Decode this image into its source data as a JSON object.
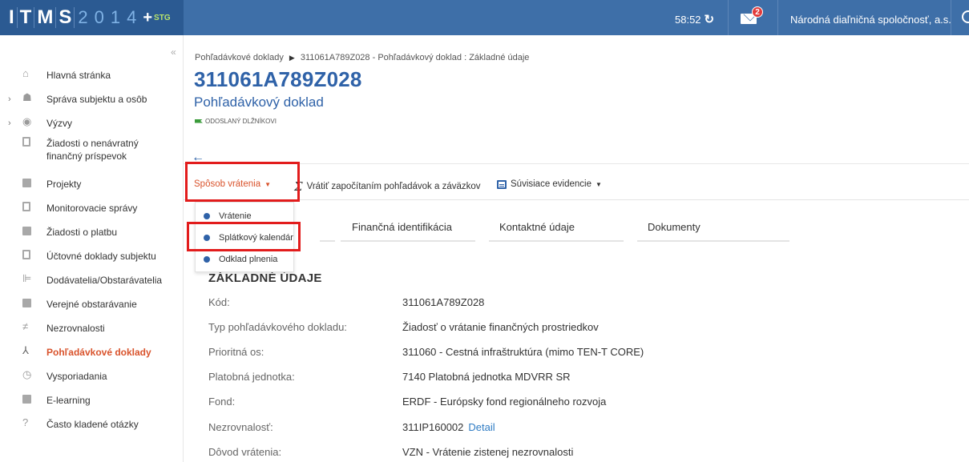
{
  "topbar": {
    "logo_letters": [
      "I",
      "T",
      "M",
      "S"
    ],
    "logo_digits": [
      "2",
      "0",
      "1",
      "4"
    ],
    "logo_plus": "+",
    "logo_env": "STG",
    "timer": "58:52",
    "mail_badge": "2",
    "organization": "Národná diaľničná spoločnosť, a.s."
  },
  "sidebar": {
    "collapse": "«",
    "items": [
      {
        "label": "Hlavná stránka",
        "icon": "home-icon"
      },
      {
        "label": "Správa subjektu a osôb",
        "icon": "people-icon",
        "expandable": true
      },
      {
        "label": "Výzvy",
        "icon": "calls-icon",
        "expandable": true
      },
      {
        "label": "Žiadosti o nenávratný finančný príspevok",
        "icon": "document-icon"
      },
      {
        "label": "Projekty",
        "icon": "projects-icon"
      },
      {
        "label": "Monitorovacie správy",
        "icon": "clipboard-icon"
      },
      {
        "label": "Žiadosti o platbu",
        "icon": "payment-icon"
      },
      {
        "label": "Účtovné doklady subjektu",
        "icon": "ledger-icon"
      },
      {
        "label": "Dodávatelia/Obstarávatelia",
        "icon": "supplier-icon"
      },
      {
        "label": "Verejné obstarávanie",
        "icon": "procurement-icon"
      },
      {
        "label": "Nezrovnalosti",
        "icon": "not-equal-icon"
      },
      {
        "label": "Pohľadávkové doklady",
        "icon": "claims-icon",
        "active": true
      },
      {
        "label": "Vysporiadania",
        "icon": "settlement-icon"
      },
      {
        "label": "E-learning",
        "icon": "book-icon"
      },
      {
        "label": "Často kladené otázky",
        "icon": "help-icon"
      }
    ]
  },
  "main": {
    "breadcrumb": {
      "parent": "Pohľadávkové doklady",
      "separator": "▶",
      "current": "311061A789Z028 - Pohľadávkový doklad : Základné údaje"
    },
    "title": "311061A789Z028",
    "subtitle": "Pohľadávkový doklad",
    "status": "ODOSLANÝ DLŽNÍKOVI",
    "back": "←",
    "actions": {
      "return_method": "Spôsob vrátenia",
      "offset": "Vrátiť započítaním pohľadávok a záväzkov",
      "related": "Súvisiace evidencie"
    },
    "dropdown": [
      "Vrátenie",
      "Splátkový kalendár",
      "Odklad plnenia"
    ],
    "tabs": [
      "Finančná identifikácia",
      "Kontaktné údaje",
      "Dokumenty"
    ],
    "section_title": "ZÁKLADNÉ ÚDAJE",
    "rows": [
      {
        "label": "Kód:",
        "value": "311061A789Z028"
      },
      {
        "label": "Typ pohľadávkového dokladu:",
        "value": "Žiadosť o vrátanie finančných prostriedkov"
      },
      {
        "label": "Prioritná os:",
        "value": "311060 - Cestná infraštruktúra (mimo TEN-T CORE)"
      },
      {
        "label": "Platobná jednotka:",
        "value": "7140 Platobná jednotka MDVRR SR"
      },
      {
        "label": "Fond:",
        "value": "ERDF - Európsky fond regionálneho rozvoja"
      },
      {
        "label": "Nezrovnalosť:",
        "value": "311IP160002",
        "link": "Detail"
      },
      {
        "label": "Dôvod vrátenia:",
        "value": "VZN - Vrátenie zistenej nezrovnalosti"
      }
    ]
  },
  "colors": {
    "topbar": "#3e6fa8",
    "logo_bg": "#2b5a92",
    "accent_blue": "#2f62a8",
    "accent_orange": "#d9532c",
    "highlight_red": "#e21c1c",
    "env_green": "#b7e36b"
  }
}
